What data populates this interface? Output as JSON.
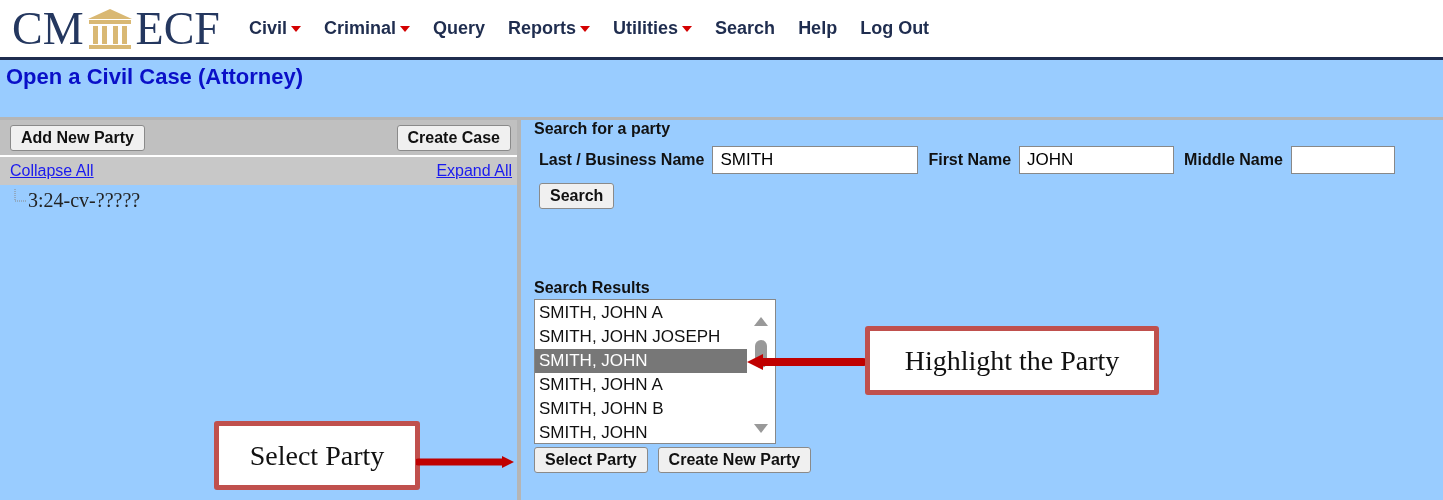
{
  "logo": {
    "left": "CM",
    "right": "ECF"
  },
  "menu": [
    {
      "label": "Civil",
      "has_dropdown": true
    },
    {
      "label": "Criminal",
      "has_dropdown": true
    },
    {
      "label": "Query",
      "has_dropdown": false
    },
    {
      "label": "Reports",
      "has_dropdown": true
    },
    {
      "label": "Utilities",
      "has_dropdown": true
    },
    {
      "label": "Search",
      "has_dropdown": false
    },
    {
      "label": "Help",
      "has_dropdown": false
    },
    {
      "label": "Log Out",
      "has_dropdown": false
    }
  ],
  "page_title": "Open a Civil Case (Attorney)",
  "left_panel": {
    "buttons": [
      "Add New Party",
      "Create Case"
    ],
    "links": [
      "Collapse All",
      "Expand All"
    ],
    "tree": [
      {
        "label": "3:24-cv-?????"
      }
    ]
  },
  "search": {
    "heading": "Search for a party",
    "fields": [
      {
        "label": "Last / Business Name",
        "value": "SMITH"
      },
      {
        "label": "First Name",
        "value": "JOHN"
      },
      {
        "label": "Middle Name"
      }
    ],
    "button": "Search"
  },
  "results": {
    "heading": "Search Results",
    "items": [
      {
        "label": "SMITH, JOHN A",
        "selected": false
      },
      {
        "label": "SMITH, JOHN JOSEPH",
        "selected": false
      },
      {
        "label": "SMITH, JOHN",
        "selected": true
      },
      {
        "label": "SMITH, JOHN A",
        "selected": false
      },
      {
        "label": "SMITH, JOHN B",
        "selected": false
      },
      {
        "label": "SMITH, JOHN",
        "selected": false
      }
    ],
    "buttons": [
      "Select Party",
      "Create New Party"
    ]
  },
  "callouts": [
    {
      "text": "Highlight the Party",
      "kind": "left"
    },
    {
      "text": "Select Party",
      "kind": "right"
    }
  ]
}
